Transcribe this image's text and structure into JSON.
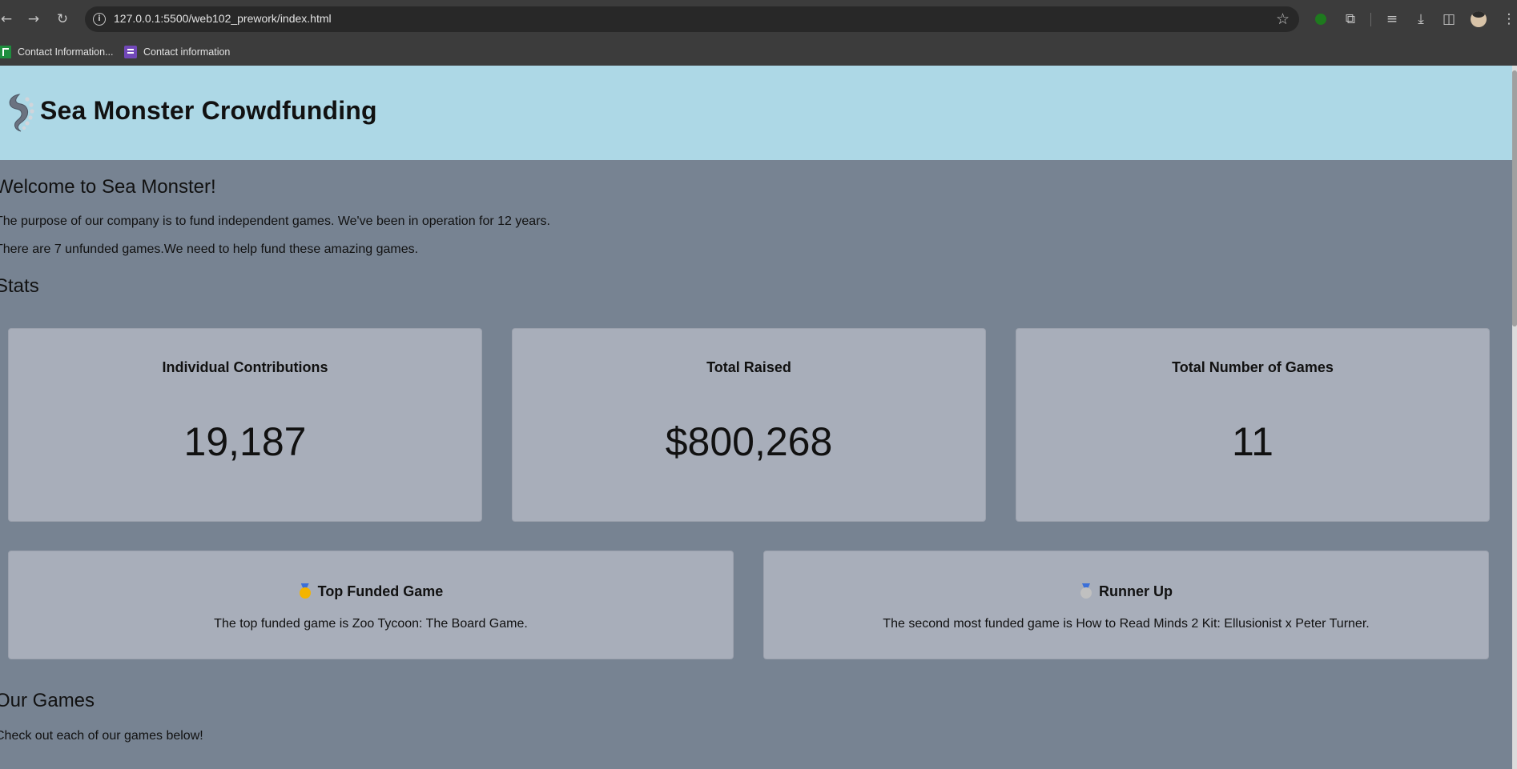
{
  "browser": {
    "url": "127.0.0.1:5500/web102_prework/index.html",
    "bookmarks": [
      {
        "label": "Contact Information...",
        "icon": "sheets-icon"
      },
      {
        "label": "Contact information",
        "icon": "forms-icon"
      }
    ]
  },
  "header": {
    "title": "Sea Monster Crowdfunding",
    "logo_icon": "tentacle-logo-icon"
  },
  "welcome": {
    "title": "Welcome to Sea Monster!",
    "purpose": "The purpose of our company is to fund independent games. We've been in operation for 12 years.",
    "unfunded": "There are 7 unfunded games.We need to help fund these amazing games."
  },
  "stats": {
    "title": "Stats",
    "cards": [
      {
        "label": "Individual Contributions",
        "value": "19,187"
      },
      {
        "label": "Total Raised",
        "value": "$800,268"
      },
      {
        "label": "Total Number of Games",
        "value": "11"
      }
    ]
  },
  "top_games": [
    {
      "title": "Top Funded Game",
      "medal": "gold-medal-icon",
      "medal_color": "#f4b400",
      "text": "The top funded game is Zoo Tycoon: The Board Game."
    },
    {
      "title": "Runner Up",
      "medal": "silver-medal-icon",
      "medal_color": "#c0c0c0",
      "text": "The second most funded game is How to Read Minds 2 Kit: Ellusionist x Peter Turner."
    }
  ],
  "games_section": {
    "title": "Our Games",
    "subtitle": "Check out each of our games below!"
  },
  "colors": {
    "header_bg": "#add8e6",
    "page_bg": "#778392",
    "card_bg": "#a8aeba"
  }
}
